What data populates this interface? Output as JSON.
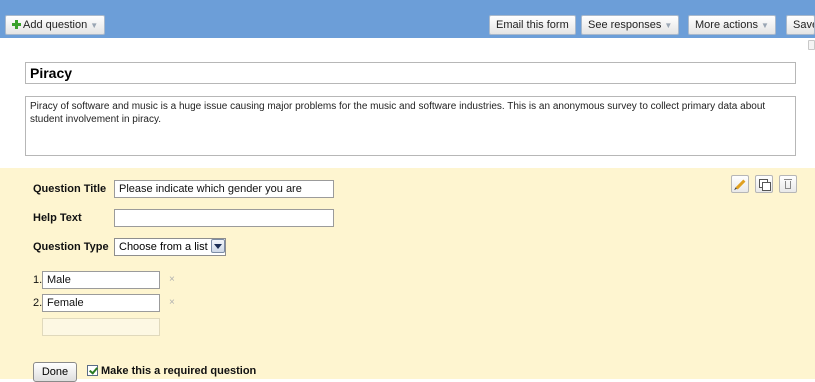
{
  "toolbar": {
    "add_question": "Add question",
    "email_form": "Email this form",
    "see_responses": "See responses",
    "more_actions": "More actions",
    "save": "Save"
  },
  "form": {
    "title": "Piracy",
    "description": "Piracy of software and music is a huge issue causing major problems for the music and software industries. This is an anonymous survey to collect primary data about student involvement in piracy."
  },
  "question": {
    "title_label": "Question Title",
    "title_value": "Please indicate which gender you are",
    "help_label": "Help Text",
    "help_value": "",
    "type_label": "Question Type",
    "type_value": "Choose from a list",
    "options": [
      {
        "number": "1.",
        "value": "Male",
        "remove": "×"
      },
      {
        "number": "2.",
        "value": "Female",
        "remove": "×"
      }
    ],
    "done": "Done",
    "required_label": "Make this a required question",
    "required_checked": true
  },
  "icons": {
    "edit": "pencil-icon",
    "duplicate": "duplicate-icon",
    "delete": "trash-icon"
  },
  "colors": {
    "toolbar_bg": "#6c9ed8",
    "panel_bg": "#fef5d0",
    "plus_green": "#3aa02c"
  }
}
